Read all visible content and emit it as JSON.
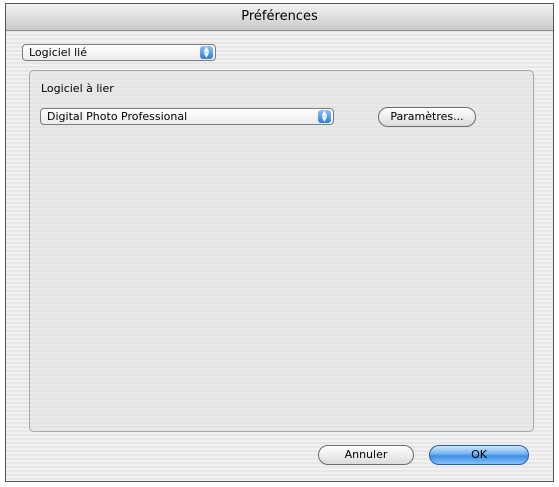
{
  "window": {
    "title": "Préférences"
  },
  "category_select": {
    "value": "Logiciel lié"
  },
  "group": {
    "label": "Logiciel à lier",
    "software_select": {
      "value": "Digital Photo Professional"
    },
    "settings_button": "Paramètres..."
  },
  "footer": {
    "cancel_label": "Annuler",
    "ok_label": "OK"
  }
}
